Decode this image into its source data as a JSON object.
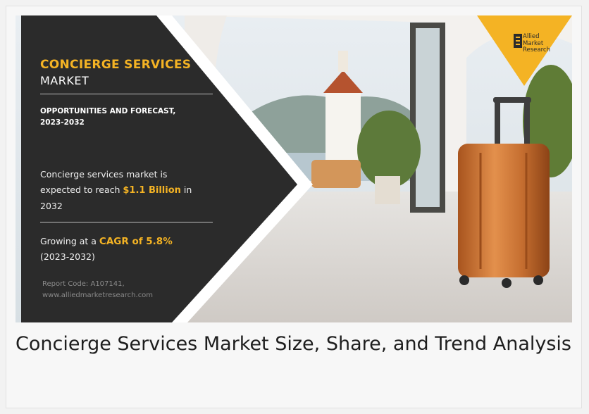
{
  "banner": {
    "title_highlight": "CONCIERGE SERVICES",
    "title_rest": "MARKET",
    "subtitle_line1": "OPPORTUNITIES AND FORECAST,",
    "subtitle_line2": "2023-2032",
    "reach_line1": "Concierge services market is",
    "reach_prefix": "expected to reach ",
    "reach_value": "$1.1 Billion",
    "reach_suffix": " in",
    "reach_line3": "2032",
    "grow_prefix": "Growing at a ",
    "grow_value": "CAGR of 5.8%",
    "grow_period": "(2023-2032)",
    "report_code": "Report Code: A107141,",
    "website": "www.alliedmarketresearch.com"
  },
  "logo": {
    "line1": "Allied",
    "line2": "Market",
    "line3": "Research"
  },
  "caption": "Concierge Services Market Size, Share,  and Trend Analysis",
  "colors": {
    "accent": "#f4b324",
    "panel": "#2b2b2b",
    "caption_text": "#1e1e1e"
  }
}
